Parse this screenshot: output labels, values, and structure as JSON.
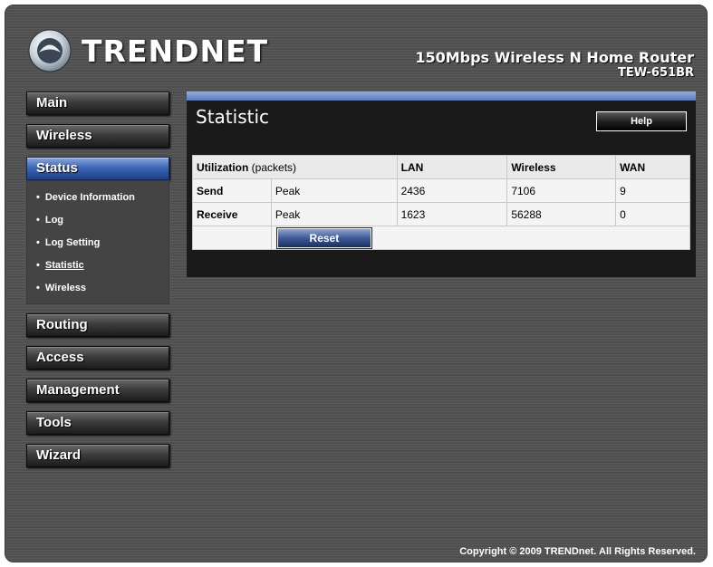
{
  "header": {
    "brand": "TRENDNET",
    "product_name": "150Mbps Wireless N Home Router",
    "model": "TEW-651BR"
  },
  "sidebar": {
    "items": [
      {
        "label": "Main"
      },
      {
        "label": "Wireless"
      },
      {
        "label": "Status",
        "active": true
      },
      {
        "label": "Routing"
      },
      {
        "label": "Access"
      },
      {
        "label": "Management"
      },
      {
        "label": "Tools"
      },
      {
        "label": "Wizard"
      }
    ],
    "status_submenu": [
      {
        "label": "Device Information"
      },
      {
        "label": "Log"
      },
      {
        "label": "Log Setting"
      },
      {
        "label": "Statistic",
        "current": true
      },
      {
        "label": "Wireless"
      }
    ]
  },
  "main": {
    "title": "Statistic",
    "help_label": "Help",
    "table": {
      "headers": {
        "utilization_bold": "Utilization",
        "utilization_light": "(packets)",
        "lan": "LAN",
        "wireless": "Wireless",
        "wan": "WAN"
      },
      "rows": [
        {
          "label": "Send",
          "type": "Peak",
          "lan": "2436",
          "wireless": "7106",
          "wan": "9"
        },
        {
          "label": "Receive",
          "type": "Peak",
          "lan": "1623",
          "wireless": "56288",
          "wan": "0"
        }
      ]
    },
    "reset_label": "Reset"
  },
  "footer": {
    "copyright": "Copyright © 2009 TRENDnet. All Rights Reserved."
  },
  "colors": {
    "accent_blue": "#3f67b6",
    "panel_bar": "#93aee0"
  }
}
